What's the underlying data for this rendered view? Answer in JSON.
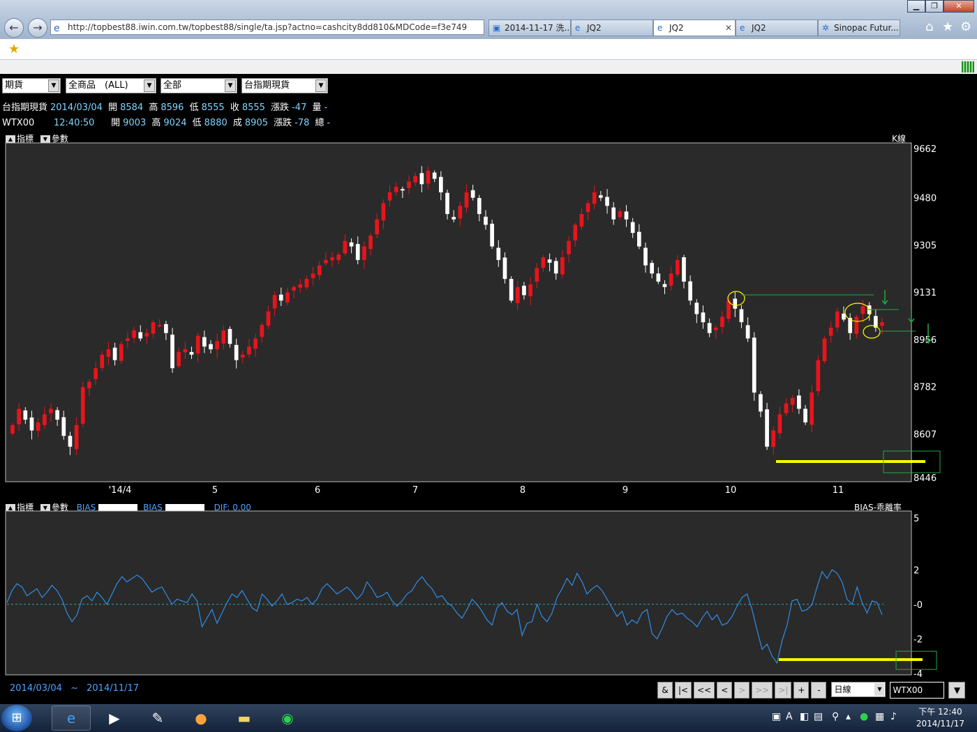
{
  "browser": {
    "address": "http://topbest88.iwin.com.tw/topbest88/single/ta.jsp?actno=cashcity8dd810&MDCode=f3e749",
    "tabs": [
      {
        "label": "2014-11-17 洗...",
        "active": false
      },
      {
        "label": "JQ2",
        "active": false
      },
      {
        "label": "JQ2",
        "active": true
      },
      {
        "label": "JQ2",
        "active": false
      },
      {
        "label": "Sinopac Futur...",
        "active": false
      }
    ],
    "window_controls": {
      "minimize": "▁",
      "maximize": "❐",
      "close": "✕"
    }
  },
  "selectors": [
    "期貨",
    "全商品　(ALL)",
    "全部",
    "台指期現貨"
  ],
  "quotes": [
    {
      "name": "台指期現貨",
      "date": "2014/03/04",
      "l_open": "開",
      "open": "8584",
      "l_high": "高",
      "high": "8596",
      "l_low": "低",
      "low": "8555",
      "l_close": "收",
      "close": "8555",
      "l_chg": "漲跌",
      "chg": "-47",
      "l_vol": "量",
      "vol": "-"
    },
    {
      "name": "WTX00",
      "date": "12:40:50",
      "l_open": "開",
      "open": "9003",
      "l_high": "高",
      "high": "9024",
      "l_low": "低",
      "low": "8880",
      "l_close": "成",
      "close": "8905",
      "l_chg": "漲跌",
      "chg": "-78",
      "l_vol": "總",
      "vol": "-"
    }
  ],
  "top_panel": {
    "btn1": "指標",
    "btn2": "參數",
    "label": "K線"
  },
  "bottom_panel": {
    "btn1": "指標",
    "btn2": "參數",
    "bias1": "BIAS",
    "bias2": "BIAS",
    "dif_label": "DIF:",
    "dif_value": "0.00",
    "label": "BIAS-乖離率"
  },
  "chart_data": [
    {
      "type": "candlestick",
      "yticks": [
        "9662",
        "9480",
        "9305",
        "9131",
        "8956",
        "8782",
        "8607",
        "8446"
      ],
      "ylim": [
        8446,
        9662
      ],
      "xticks": [
        "'14/4",
        "5",
        "6",
        "7",
        "8",
        "9",
        "10",
        "11"
      ],
      "colors": {
        "up": "#e8141c",
        "down": "#ffffff",
        "annotation": "#ffff00",
        "guide": "#22aa44"
      }
    },
    {
      "type": "line",
      "yticks": [
        "5",
        "2",
        "-0",
        "-2",
        "-4"
      ],
      "ylim": [
        -4,
        5
      ],
      "series": [
        {
          "values": [
            0.1,
            0.8,
            1.2,
            1.0,
            0.5,
            0.7,
            0.9,
            0.4,
            0.7,
            1.1,
            0.8,
            0.3,
            -0.5,
            -1.0,
            -0.6,
            0.3,
            0.5,
            0.2,
            0.7,
            0.4,
            0.0,
            0.6,
            1.2,
            1.6,
            1.3,
            1.5,
            1.7,
            1.5,
            1.1,
            0.7,
            0.9,
            1.0,
            0.5,
            0.0,
            0.3,
            0.2,
            0.1,
            0.6,
            0.2,
            -1.3,
            -0.8,
            -0.3,
            -1.1,
            -0.5,
            0.1,
            0.6,
            0.4,
            0.8,
            0.3,
            -0.2,
            -0.4,
            0.6,
            0.3,
            -0.1,
            0.2,
            0.6,
            0.0,
            0.1,
            0.3,
            0.2,
            0.4,
            0.0,
            0.3,
            0.9,
            1.2,
            0.9,
            0.6,
            0.8,
            1.0,
            0.7,
            0.3,
            0.6,
            1.3,
            0.9,
            0.4,
            0.5,
            0.7,
            0.2,
            -0.1,
            0.2,
            0.6,
            0.8,
            1.3,
            1.6,
            1.2,
            0.9,
            0.4,
            0.5,
            0.1,
            -0.1,
            -0.5,
            -0.8,
            -0.3,
            0.3,
            0.0,
            -0.4,
            -0.9,
            -1.2,
            -0.2,
            0.1,
            -0.4,
            -0.6,
            -0.3,
            -1.8,
            -1.1,
            -1.0,
            0.0,
            -0.7,
            -1.0,
            -0.5,
            0.4,
            0.9,
            1.5,
            1.1,
            1.8,
            1.3,
            0.6,
            0.9,
            1.1,
            0.8,
            0.3,
            -0.2,
            -0.7,
            -0.4,
            -1.2,
            -0.9,
            -1.1,
            -0.5,
            -0.3,
            -1.7,
            -2.0,
            -1.4,
            -0.7,
            -0.3,
            -0.6,
            -0.5,
            -0.8,
            -1.0,
            -1.3,
            -0.8,
            -0.4,
            -0.9,
            -0.6,
            -1.2,
            -1.1,
            -0.7,
            -0.1,
            0.4,
            0.6,
            -0.3,
            -1.5,
            -2.6,
            -2.3,
            -3.0,
            -3.4,
            -2.1,
            -1.2,
            0.2,
            0.3,
            -0.4,
            -0.3,
            0.0,
            1.0,
            1.9,
            1.5,
            2.0,
            1.8,
            1.3,
            0.3,
            0.0,
            1.0,
            0.1,
            -0.5,
            0.2,
            0.1,
            -0.6
          ],
          "color": "#2f8ee8"
        }
      ],
      "zero_line_color": "#2fa8a8",
      "annotation_value": -3.2
    }
  ],
  "range": {
    "start": "2014/03/04",
    "sep": "~",
    "end": "2014/11/17"
  },
  "controls": {
    "buttons": [
      "&",
      "|<",
      "<<",
      "<",
      ">",
      ">>",
      ">|",
      "+",
      "-"
    ],
    "period": "日線",
    "symbol": "WTX00"
  },
  "taskbar": {
    "clock_time": "下午 12:40",
    "clock_date": "2014/11/17",
    "apps": [
      "ie-icon",
      "media-player-icon",
      "app-icon",
      "orb-icon",
      "folder-icon",
      "line-icon"
    ]
  }
}
